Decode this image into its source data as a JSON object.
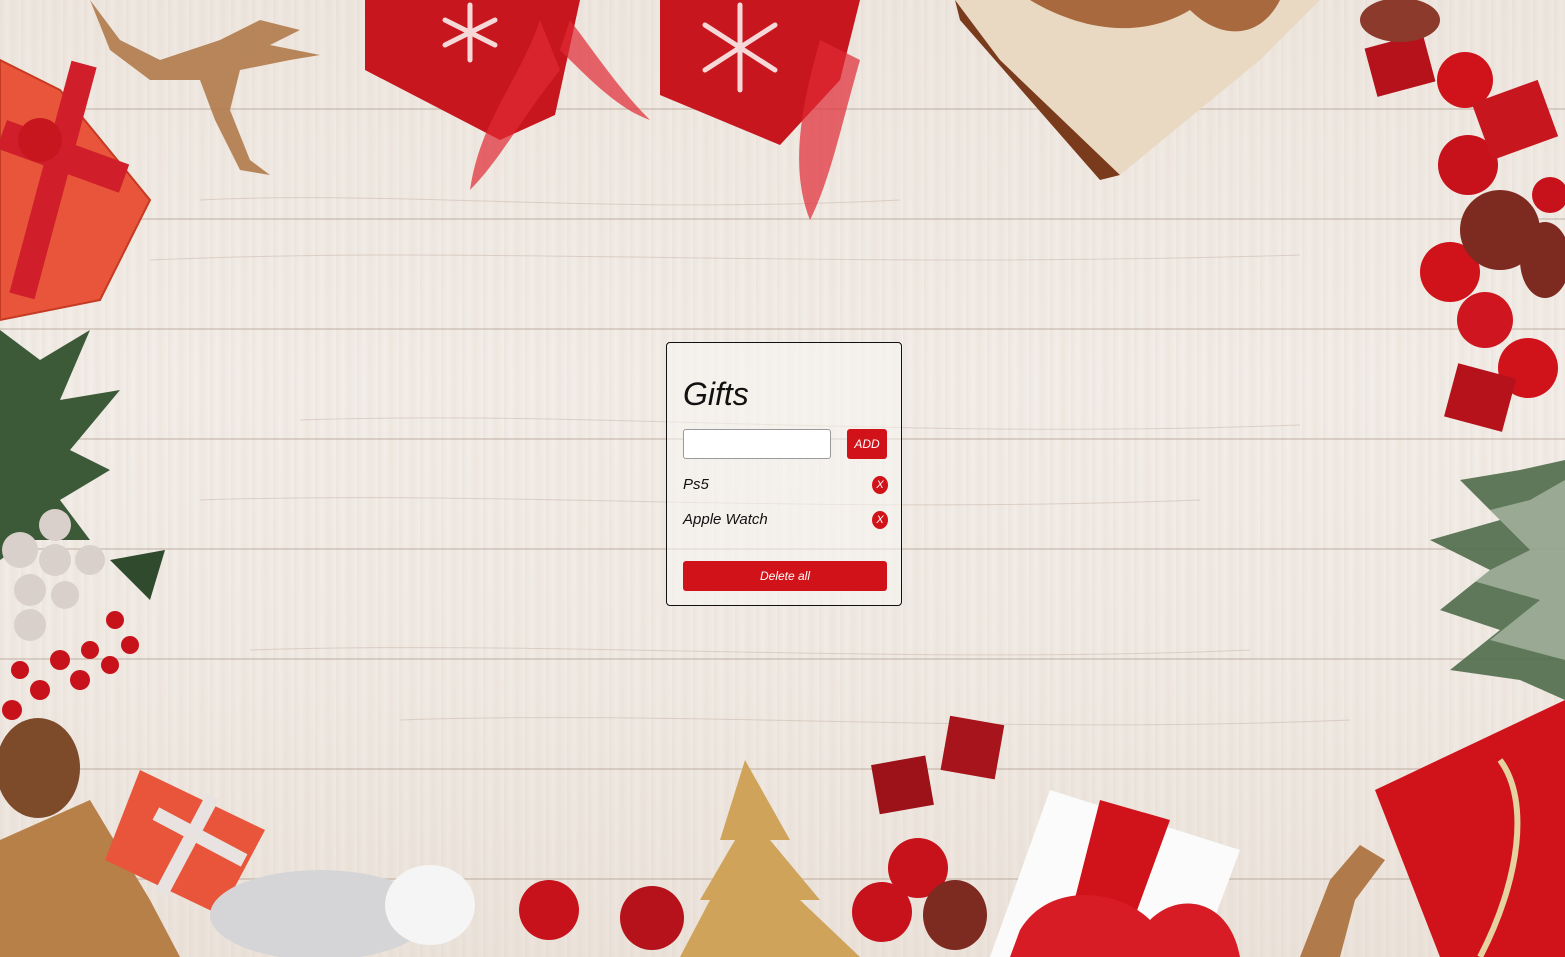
{
  "app": {
    "title": "Gifts"
  },
  "form": {
    "input_value": "",
    "input_placeholder": "",
    "add_label": "ADD"
  },
  "gifts": [
    {
      "name": "Ps5",
      "remove_label": "X"
    },
    {
      "name": "Apple Watch",
      "remove_label": "X"
    }
  ],
  "actions": {
    "delete_all_label": "Delete all"
  },
  "theme": {
    "accent": "#d11218",
    "background": "#f1ebe5",
    "text": "#111111"
  }
}
